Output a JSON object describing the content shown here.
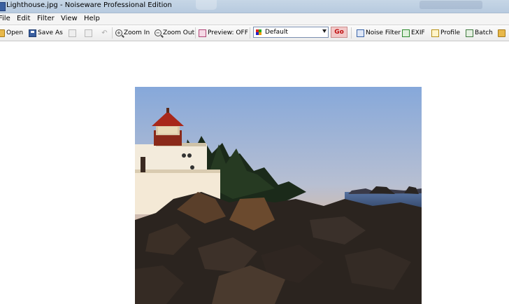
{
  "window": {
    "title": "Lighthouse.jpg - Noiseware Professional Edition"
  },
  "menu": {
    "file": "File",
    "edit": "Edit",
    "filter": "Filter",
    "view": "View",
    "help": "Help"
  },
  "toolbar": {
    "open": "Open",
    "save_as": "Save As",
    "zoom_in": "Zoom In",
    "zoom_out": "Zoom Out",
    "preview": "Preview: OFF",
    "preset_value": "Default",
    "go": "Go",
    "noise_filter": "Noise Filter",
    "exif": "EXIF",
    "profile": "Profile",
    "batch": "Batch"
  },
  "colors": {
    "sky_top": "#87a9dc",
    "sky_horizon": "#f0b57c",
    "accent_go": "#c01010"
  },
  "icons": [
    "app-icon",
    "open-icon",
    "save-icon",
    "copy-icon",
    "paste-icon",
    "undo-icon",
    "zoom-in-icon",
    "zoom-out-icon",
    "preview-icon",
    "preset-icon",
    "noise-filter-icon",
    "exif-icon",
    "profile-icon",
    "batch-icon"
  ]
}
